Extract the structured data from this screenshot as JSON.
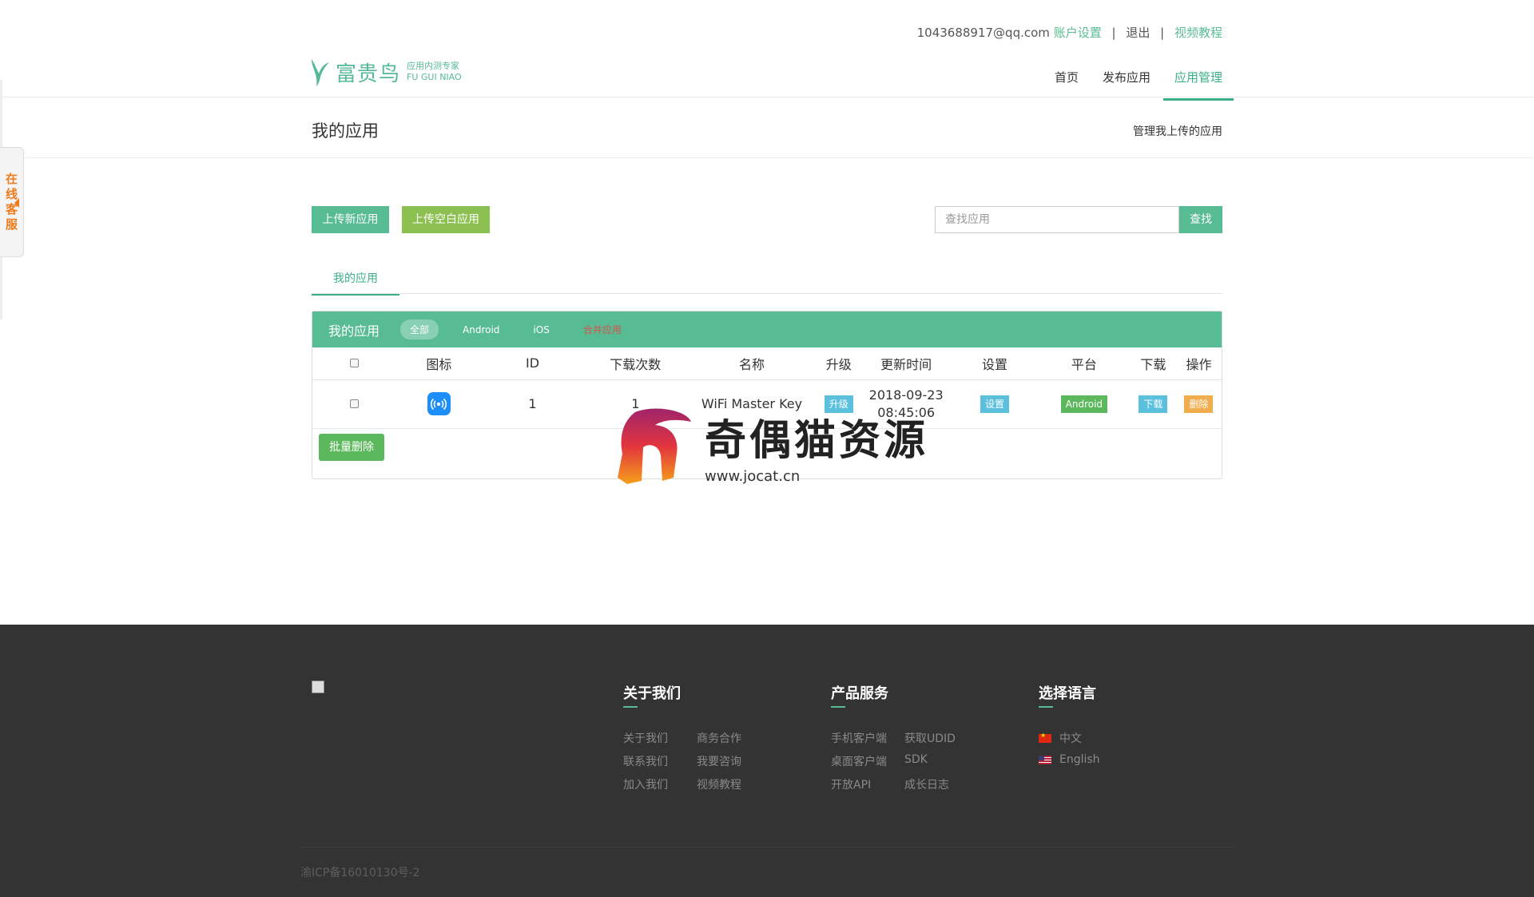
{
  "header": {
    "account_email": "1043688917@qq.com",
    "account_settings": "账户设置",
    "logout": "退出",
    "video_tutorial": "视频教程",
    "sep": "|",
    "logo_name": "富贵鸟",
    "logo_tagline": "应用内测专家",
    "logo_pinyin": "FU GUI NIAO",
    "nav": [
      "首页",
      "发布应用",
      "应用管理"
    ]
  },
  "side_service": [
    "在",
    "线",
    "客",
    "服"
  ],
  "page": {
    "title": "我的应用",
    "description": "管理我上传的应用"
  },
  "actions": {
    "upload_new": "上传新应用",
    "upload_blank": "上传空白应用",
    "search_placeholder": "查找应用",
    "search_button": "查找"
  },
  "tabs": [
    "我的应用"
  ],
  "panel": {
    "title": "我的应用",
    "filters": [
      "全部",
      "Android",
      "iOS",
      "合并应用"
    ],
    "columns": [
      "图标",
      "ID",
      "下载次数",
      "名称",
      "升级",
      "更新时间",
      "设置",
      "平台",
      "下载",
      "操作"
    ],
    "rows": [
      {
        "id": "1",
        "downloads": "1",
        "name": "WiFi Master Key",
        "upgrade": "升级",
        "date": "2018-09-23",
        "time": "08:45:06",
        "settings": "设置",
        "platform": "Android",
        "download": "下载",
        "delete": "删除"
      }
    ],
    "batch_delete": "批量删除"
  },
  "watermark": {
    "cn": "奇偶猫资源",
    "url": "www.jocat.cn"
  },
  "footer": {
    "about_title": "关于我们",
    "about_links": [
      "关于我们",
      "商务合作",
      "联系我们",
      "我要咨询",
      "加入我们",
      "视频教程"
    ],
    "product_title": "产品服务",
    "product_links": [
      "手机客户端",
      "获取UDID",
      "桌面客户端",
      "SDK",
      "开放API",
      "成长日志"
    ],
    "lang_title": "选择语言",
    "lang_cn": "中文",
    "lang_en": "English",
    "icp": "渝ICP备16010130号-2"
  },
  "colors": {
    "brand": "#57bb93",
    "accent_green": "#8cc152",
    "footer_bg": "#333333",
    "service_orange": "#f07b1d"
  }
}
